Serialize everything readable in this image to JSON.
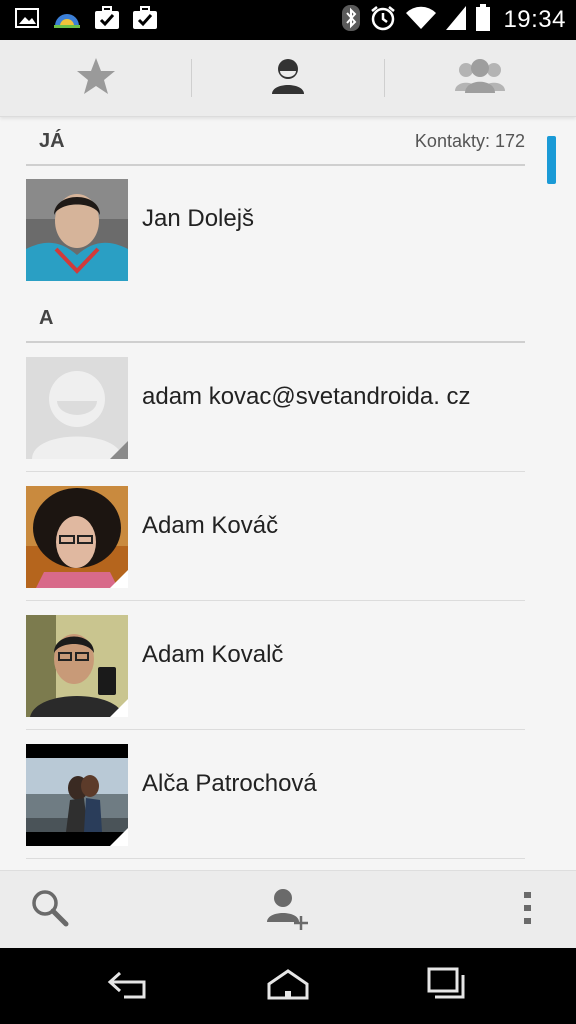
{
  "status_bar": {
    "time": "19:34",
    "left_icons": [
      "gallery-icon",
      "weather-icon",
      "briefcase-check-icon",
      "briefcase-check-icon"
    ],
    "right_icons": [
      "bluetooth-icon",
      "alarm-icon",
      "wifi-icon",
      "signal-icon",
      "battery-icon"
    ]
  },
  "tabs": [
    {
      "name": "favorites",
      "icon": "star-icon",
      "selected": false
    },
    {
      "name": "contacts",
      "icon": "person-icon",
      "selected": true
    },
    {
      "name": "groups",
      "icon": "group-icon",
      "selected": false
    }
  ],
  "sections": {
    "me": {
      "letter": "JÁ",
      "count_label": "Kontakty: 172"
    },
    "a": {
      "letter": "A"
    }
  },
  "contacts": [
    {
      "name": "Jan Dolejš",
      "avatar": "photo"
    },
    {
      "name": "adam kovac@svetandroida. cz",
      "avatar": "placeholder"
    },
    {
      "name": "Adam Kováč",
      "avatar": "photo"
    },
    {
      "name": "Adam Kovalč",
      "avatar": "photo"
    },
    {
      "name": "Alča Patrochová",
      "avatar": "photo"
    }
  ],
  "actions": [
    "search-icon",
    "add-contact-icon",
    "overflow-menu-icon"
  ],
  "nav": [
    "back-icon",
    "home-icon",
    "recents-icon"
  ],
  "colors": {
    "accent": "#1a9ad6",
    "bar": "#ececec",
    "background": "#f5f5f5"
  }
}
